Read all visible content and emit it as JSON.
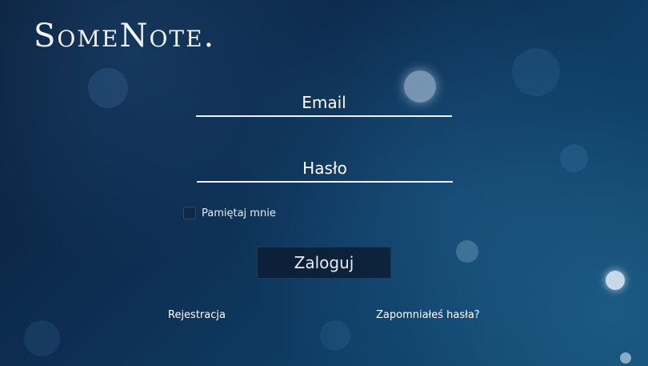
{
  "brand": {
    "logo_text": "SomeNote."
  },
  "form": {
    "email_placeholder": "Email",
    "password_placeholder": "Hasło",
    "remember_label": "Pamiętaj mnie",
    "remember_checked": false,
    "login_label": "Zaloguj"
  },
  "links": {
    "register": "Rejestracja",
    "forgot_password": "Zapomniałeś hasła?"
  },
  "colors": {
    "background_top": "#0a1f3a",
    "background_bottom": "#114a73",
    "underline": "#f0f0f0",
    "button_bg": "#0c1c32"
  }
}
